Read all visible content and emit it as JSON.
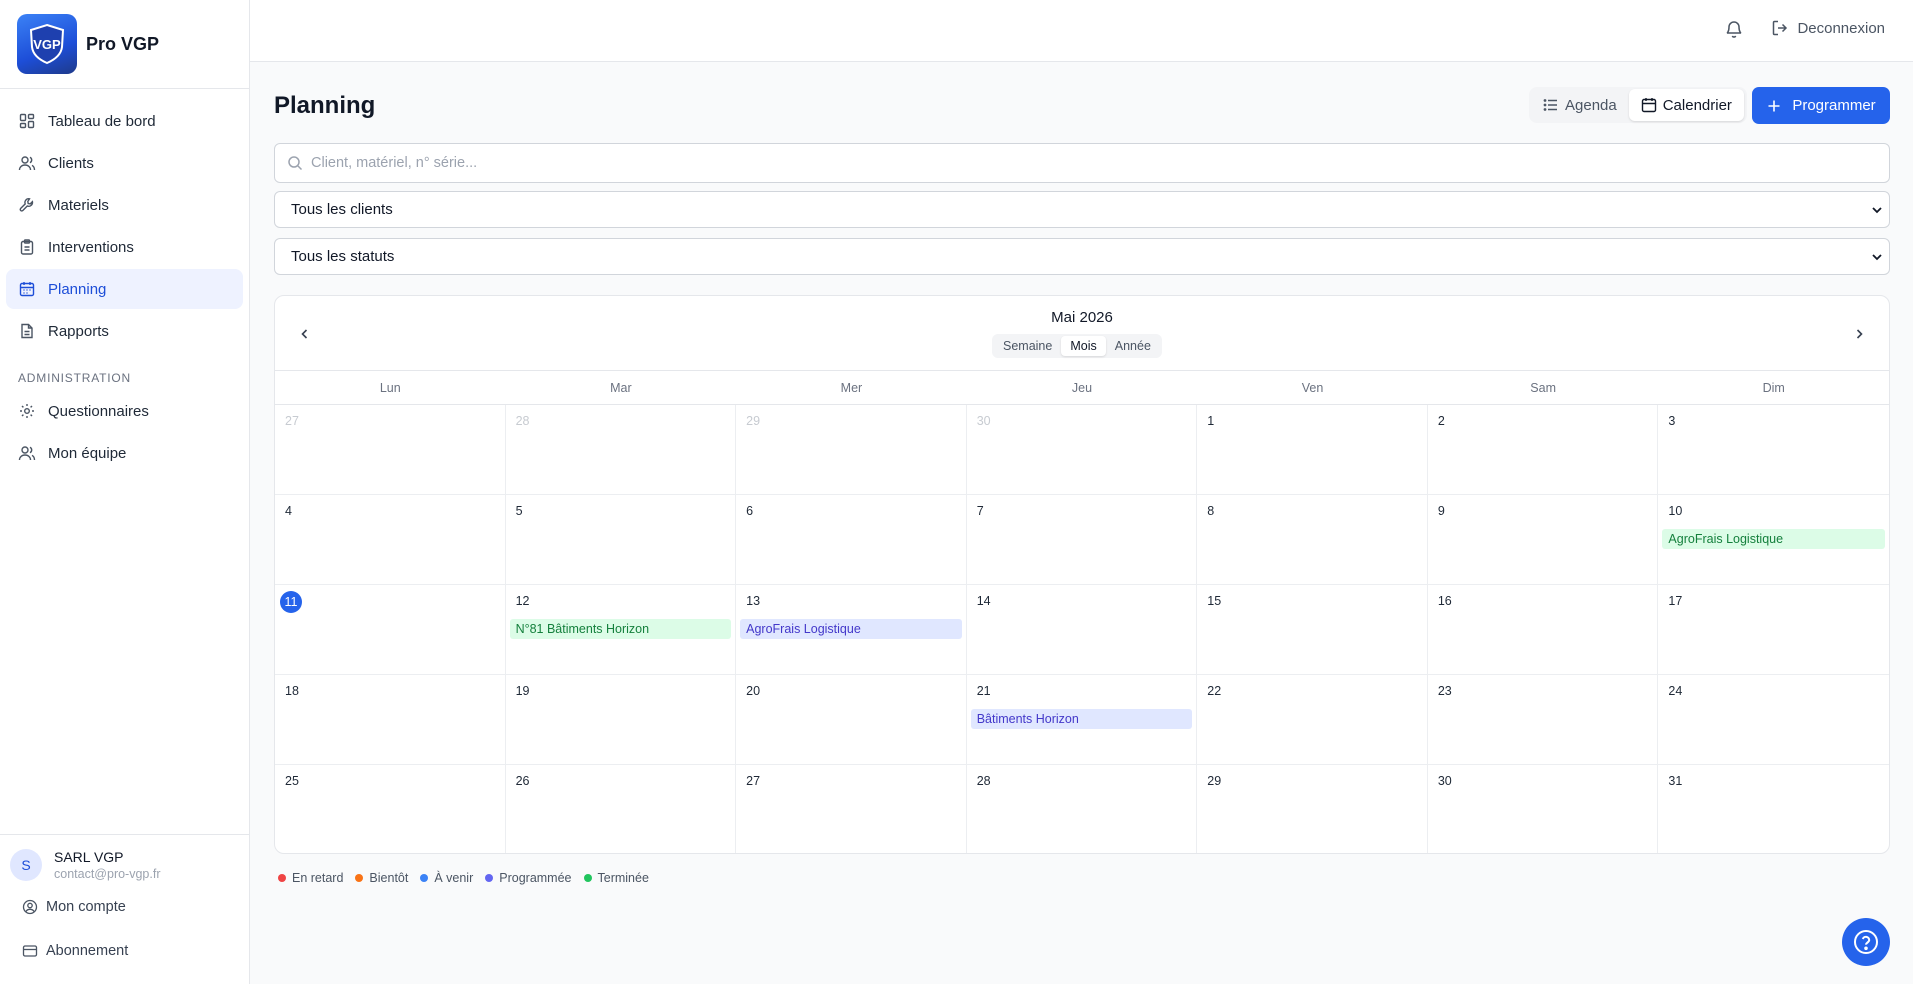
{
  "brand": {
    "name": "Pro VGP",
    "logo_text": "VGP"
  },
  "sidebar": {
    "items": [
      {
        "label": "Tableau de bord",
        "icon": "dashboard-icon"
      },
      {
        "label": "Clients",
        "icon": "users-icon"
      },
      {
        "label": "Materiels",
        "icon": "wrench-icon"
      },
      {
        "label": "Interventions",
        "icon": "clipboard-icon"
      },
      {
        "label": "Planning",
        "icon": "calendar-icon",
        "active": true
      },
      {
        "label": "Rapports",
        "icon": "file-icon"
      }
    ],
    "section_label": "Administration",
    "admin_items": [
      {
        "label": "Questionnaires",
        "icon": "gear-icon"
      },
      {
        "label": "Mon équipe",
        "icon": "team-icon"
      }
    ]
  },
  "user": {
    "initial": "S",
    "name": "SARL VGP",
    "email": "contact@pro-vgp.fr",
    "account_label": "Mon compte",
    "subscription_label": "Abonnement"
  },
  "topbar": {
    "logout_label": "Deconnexion"
  },
  "page": {
    "title": "Planning",
    "view_agenda": "Agenda",
    "view_calendar": "Calendrier",
    "program_button": "Programmer"
  },
  "filters": {
    "search_placeholder": "Client, matériel, n° série...",
    "clients_select": "Tous les clients",
    "status_select": "Tous les statuts"
  },
  "calendar": {
    "title": "Mai 2026",
    "ranges": [
      "Semaine",
      "Mois",
      "Année"
    ],
    "active_range": "Mois",
    "weekdays": [
      "Lun",
      "Mar",
      "Mer",
      "Jeu",
      "Ven",
      "Sam",
      "Dim"
    ],
    "days": [
      {
        "n": "27",
        "other": true
      },
      {
        "n": "28",
        "other": true
      },
      {
        "n": "29",
        "other": true
      },
      {
        "n": "30",
        "other": true
      },
      {
        "n": "1"
      },
      {
        "n": "2"
      },
      {
        "n": "3"
      },
      {
        "n": "4"
      },
      {
        "n": "5"
      },
      {
        "n": "6"
      },
      {
        "n": "7"
      },
      {
        "n": "8"
      },
      {
        "n": "9"
      },
      {
        "n": "10",
        "events": [
          {
            "label": "AgroFrais Logistique",
            "color": "green"
          }
        ]
      },
      {
        "n": "11",
        "today": true
      },
      {
        "n": "12",
        "events": [
          {
            "label": "N°81 Bâtiments Horizon",
            "color": "green"
          }
        ]
      },
      {
        "n": "13",
        "events": [
          {
            "label": "AgroFrais Logistique",
            "color": "blue"
          }
        ]
      },
      {
        "n": "14"
      },
      {
        "n": "15"
      },
      {
        "n": "16"
      },
      {
        "n": "17"
      },
      {
        "n": "18"
      },
      {
        "n": "19"
      },
      {
        "n": "20"
      },
      {
        "n": "21",
        "events": [
          {
            "label": "Bâtiments Horizon",
            "color": "blue"
          }
        ]
      },
      {
        "n": "22"
      },
      {
        "n": "23"
      },
      {
        "n": "24"
      },
      {
        "n": "25"
      },
      {
        "n": "26"
      },
      {
        "n": "27"
      },
      {
        "n": "28"
      },
      {
        "n": "29"
      },
      {
        "n": "30"
      },
      {
        "n": "31"
      }
    ]
  },
  "legend": [
    {
      "label": "En retard",
      "color": "#ef4444"
    },
    {
      "label": "Bientôt",
      "color": "#f97316"
    },
    {
      "label": "À venir",
      "color": "#3b82f6"
    },
    {
      "label": "Programmée",
      "color": "#6366f1"
    },
    {
      "label": "Terminée",
      "color": "#22c55e"
    }
  ],
  "colors": {
    "accent": "#2563eb",
    "active_nav_bg": "#eef2ff"
  }
}
